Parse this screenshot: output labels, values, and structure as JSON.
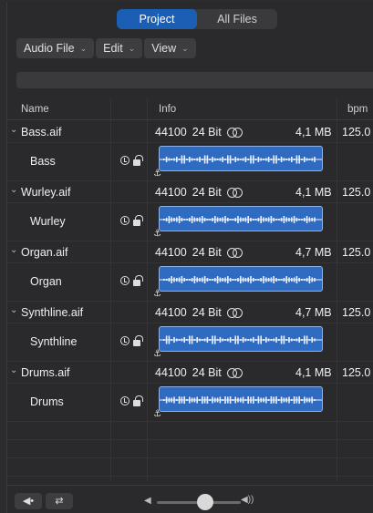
{
  "tabs": [
    {
      "label": "Project",
      "active": true
    },
    {
      "label": "All Files",
      "active": false
    }
  ],
  "menus": [
    {
      "label": "Audio File"
    },
    {
      "label": "Edit"
    },
    {
      "label": "View"
    }
  ],
  "header": {
    "name": "Name",
    "info": "Info",
    "bpm": "bpm"
  },
  "files": [
    {
      "file": "Bass.aif",
      "region": "Bass",
      "rate": "44100",
      "bits": "24 Bit",
      "size": "4,1 MB",
      "bpm": "125.0"
    },
    {
      "file": "Wurley.aif",
      "region": "Wurley",
      "rate": "44100",
      "bits": "24 Bit",
      "size": "4,1 MB",
      "bpm": "125.0"
    },
    {
      "file": "Organ.aif",
      "region": "Organ",
      "rate": "44100",
      "bits": "24 Bit",
      "size": "4,7 MB",
      "bpm": "125.0"
    },
    {
      "file": "Synthline.aif",
      "region": "Synthline",
      "rate": "44100",
      "bits": "24 Bit",
      "size": "4,7 MB",
      "bpm": "125.0"
    },
    {
      "file": "Drums.aif",
      "region": "Drums",
      "rate": "44100",
      "bits": "24 Bit",
      "size": "4,1 MB",
      "bpm": "125.0"
    }
  ],
  "colors": {
    "accent": "#1a5fb4",
    "waveform_fill": "#2f6bc0"
  },
  "icons": {
    "disclosure": "chevron-down-icon",
    "stereo": "stereo-icon",
    "clock": "clock-icon",
    "lock": "lock-icon",
    "anchor": "anchor-icon"
  }
}
